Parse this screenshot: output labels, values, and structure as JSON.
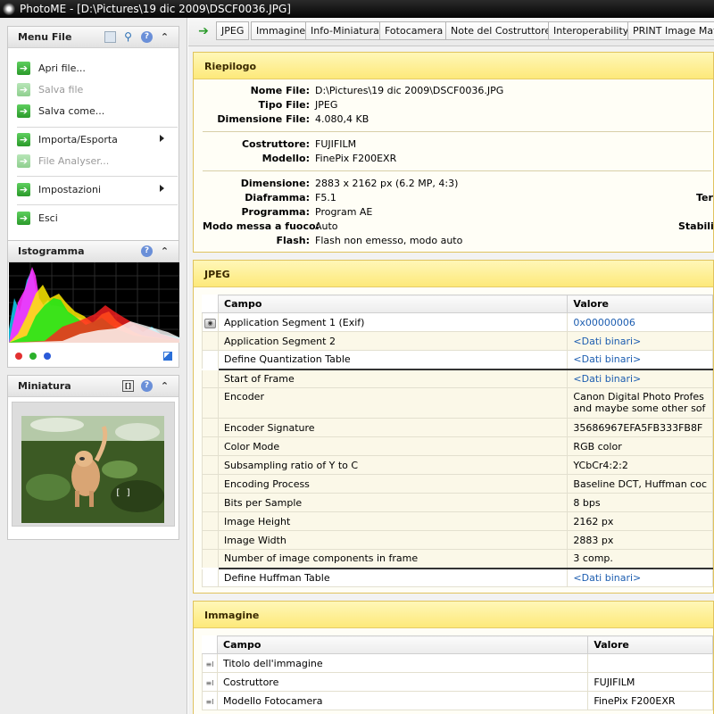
{
  "window": {
    "title": "PhotoME - [D:\\Pictures\\19 dic 2009\\DSCF0036.JPG]"
  },
  "menu_panel": {
    "title": "Menu File",
    "items": [
      {
        "label": "Apri file...",
        "enabled": true
      },
      {
        "label": "Salva file",
        "enabled": false
      },
      {
        "label": "Salva come...",
        "enabled": true
      },
      {
        "label": "Importa/Esporta",
        "enabled": true,
        "submenu": true
      },
      {
        "label": "File Analyser...",
        "enabled": false
      },
      {
        "label": "Impostazioni",
        "enabled": true,
        "submenu": true
      },
      {
        "label": "Esci",
        "enabled": true
      }
    ]
  },
  "histogram_panel": {
    "title": "Istogramma"
  },
  "thumbnail_panel": {
    "title": "Miniatura",
    "focus_marker": "[ ]"
  },
  "tabs": [
    "JPEG",
    "Immagine",
    "Info-Miniatura",
    "Fotocamera",
    "Note del Costruttore",
    "Interoperability",
    "PRINT Image Matc"
  ],
  "riepilogo": {
    "title": "Riepilogo",
    "file": [
      {
        "label": "Nome File:",
        "value": "D:\\Pictures\\19 dic 2009\\DSCF0036.JPG"
      },
      {
        "label": "Tipo File:",
        "value": "JPEG"
      },
      {
        "label": "Dimensione File:",
        "value": "4.080,4 KB"
      }
    ],
    "camera": [
      {
        "label": "Costruttore:",
        "value": "FUJIFILM"
      },
      {
        "label": "Modello:",
        "value": "FinePix F200EXR"
      }
    ],
    "shot": [
      {
        "label": "Dimensione:",
        "value": "2883 x 2162 px (6.2 MP, 4:3)"
      },
      {
        "label": "Diaframma:",
        "value": "F5.1"
      },
      {
        "label": "Programma:",
        "value": "Program AE"
      },
      {
        "label": "Modo messa a fuoco:",
        "value": "Auto"
      },
      {
        "label": "Flash:",
        "value": "Flash non emesso, modo auto"
      }
    ],
    "right_cut": [
      "Ter",
      "Stabiliz"
    ]
  },
  "jpeg_section": {
    "title": "JPEG",
    "columns": [
      "Campo",
      "Valore"
    ],
    "rows": [
      {
        "campo": "Application Segment 1 (Exif)",
        "valore": "0x00000006",
        "icon": "exif",
        "link": true
      },
      {
        "campo": "Application Segment 2",
        "valore": "<Dati binari>",
        "link": true
      },
      {
        "campo": "Define Quantization Table",
        "valore": "<Dati binari>",
        "link": true
      },
      {
        "campo": "Start of Frame",
        "valore": "<Dati binari>",
        "link": true,
        "topline": true
      },
      {
        "campo": "Encoder",
        "valore": "Canon Digital Photo Profes",
        "valore2": "and maybe some other sof",
        "tall": true
      },
      {
        "campo": "Encoder Signature",
        "valore": "35686967EFA5FB333FB8F"
      },
      {
        "campo": "Color Mode",
        "valore": "RGB color"
      },
      {
        "campo": "Subsampling ratio of Y to C",
        "valore": "YCbCr4:2:2"
      },
      {
        "campo": "Encoding Process",
        "valore": "Baseline DCT, Huffman coc"
      },
      {
        "campo": "Bits per Sample",
        "valore": "8 bps"
      },
      {
        "campo": "Image Height",
        "valore": "2162 px"
      },
      {
        "campo": "Image Width",
        "valore": "2883 px"
      },
      {
        "campo": "Number of image components in frame",
        "valore": "3 comp."
      },
      {
        "campo": "Define Huffman Table",
        "valore": "<Dati binari>",
        "link": true,
        "topline": true
      }
    ]
  },
  "immagine_section": {
    "title": "Immagine",
    "columns": [
      "Campo",
      "Valore"
    ],
    "rows": [
      {
        "campo": "Titolo dell'immagine",
        "valore": ""
      },
      {
        "campo": "Costruttore",
        "valore": "FUJIFILM"
      },
      {
        "campo": "Modello Fotocamera",
        "valore": "FinePix F200EXR"
      }
    ]
  },
  "colors": {
    "accent_link": "#1c5db0",
    "section_header": "#fde97a",
    "titlebar": "#0a0a0a"
  }
}
